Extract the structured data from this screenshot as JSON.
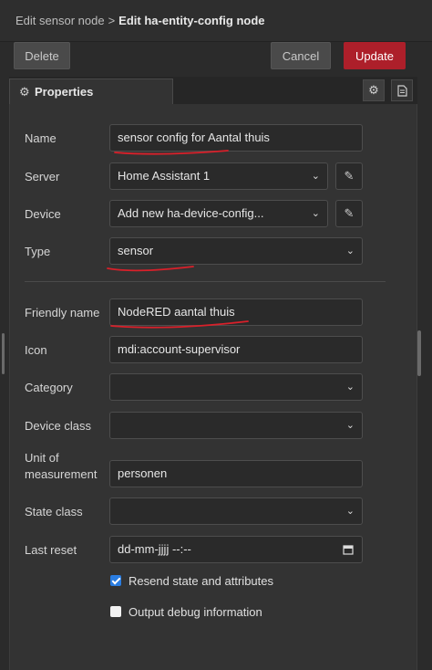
{
  "header": {
    "breadcrumb_parent": "Edit sensor node",
    "breadcrumb_separator": ">",
    "breadcrumb_current": "Edit ha-entity-config node"
  },
  "toolbar": {
    "delete_label": "Delete",
    "cancel_label": "Cancel",
    "update_label": "Update"
  },
  "tabs": {
    "properties_label": "Properties",
    "settings_icon": "gear-icon",
    "description_icon": "document-icon"
  },
  "form": {
    "name": {
      "label": "Name",
      "value": "sensor config for Aantal thuis"
    },
    "server": {
      "label": "Server",
      "value": "Home Assistant 1"
    },
    "device": {
      "label": "Device",
      "value": "Add new ha-device-config..."
    },
    "type": {
      "label": "Type",
      "value": "sensor"
    },
    "friendly_name": {
      "label": "Friendly name",
      "value": "NodeRED aantal thuis"
    },
    "icon": {
      "label": "Icon",
      "value": "mdi:account-supervisor"
    },
    "category": {
      "label": "Category",
      "value": ""
    },
    "device_class": {
      "label": "Device class",
      "value": ""
    },
    "unit": {
      "label_line1": "Unit of",
      "label_line2": "measurement",
      "value": "personen"
    },
    "state_class": {
      "label": "State class",
      "value": ""
    },
    "last_reset": {
      "label": "Last reset",
      "value": "dd-mm-jjjj --:--"
    },
    "resend": {
      "label": "Resend state and attributes",
      "checked": true
    },
    "debug": {
      "label": "Output debug information",
      "checked": false
    }
  },
  "colors": {
    "update_button": "#ad1f2a",
    "checkbox_accent": "#2a7de1",
    "annotation_underline": "#d9202a"
  }
}
